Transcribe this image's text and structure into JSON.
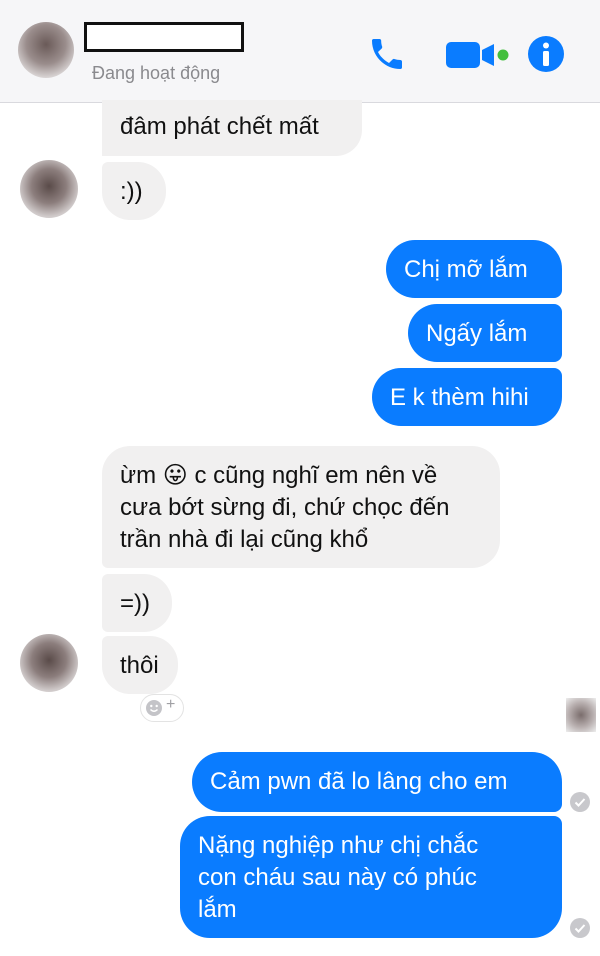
{
  "header": {
    "status": "Đang hoạt động",
    "icons": [
      "phone-icon",
      "video-camera-icon",
      "info-icon"
    ],
    "accent": "#0a7cff"
  },
  "messages": [
    {
      "side": "in",
      "text": "đâm phát chết mất"
    },
    {
      "side": "in",
      "text": ":))"
    },
    {
      "side": "out",
      "text": "Chị mỡ lắm"
    },
    {
      "side": "out",
      "text": "Ngấy lắm"
    },
    {
      "side": "out",
      "text": "E k thèm hihi"
    },
    {
      "side": "in",
      "lines": [
        "c cũng nghĩ em nên về",
        "cưa bớt sừng đi, chứ chọc đến",
        "trần nhà đi lại cũng khổ"
      ],
      "prefix": "ừm",
      "emoji": "😛"
    },
    {
      "side": "in",
      "text": "=))"
    },
    {
      "side": "in",
      "text": "thôi"
    },
    {
      "side": "out",
      "text": "Cảm pwn đã lo lâng cho em"
    },
    {
      "side": "out",
      "lines": [
        "Nặng nghiệp như chị chắc",
        "con cháu sau này có phúc",
        "lắm"
      ]
    }
  ],
  "reaction_button": {
    "label": "+"
  }
}
